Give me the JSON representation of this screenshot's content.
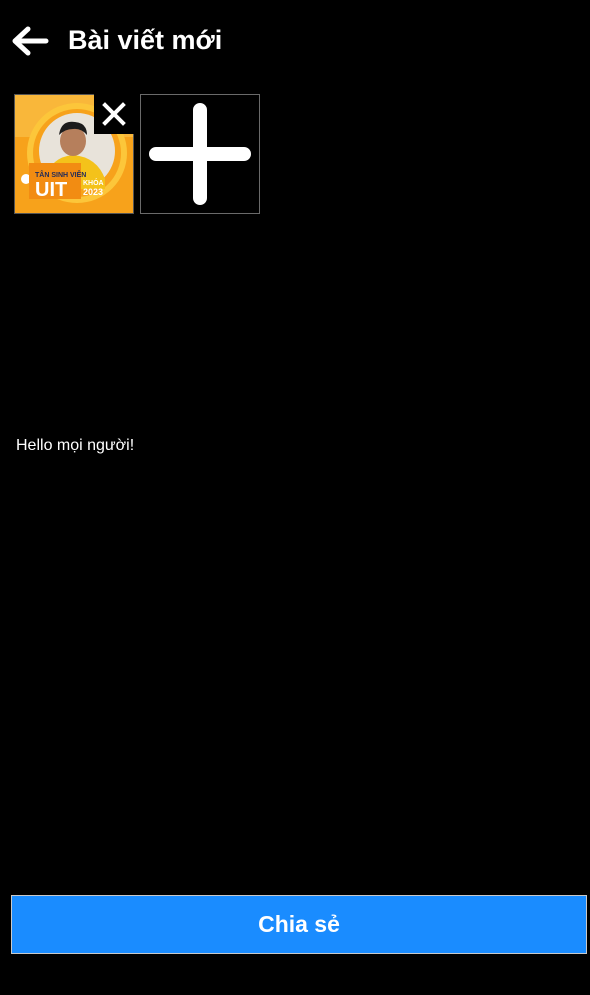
{
  "header": {
    "title": "Bài viết mới",
    "back_icon": "arrow-left-icon"
  },
  "media": {
    "thumbnail": {
      "badge_lines": [
        "TÂN SINH VIÊN",
        "UIT",
        "KHÓA",
        "2023"
      ],
      "remove_icon": "close-icon"
    },
    "add_icon": "plus-icon"
  },
  "post": {
    "caption": "Hello mọi người!"
  },
  "actions": {
    "share_label": "Chia sẻ"
  },
  "colors": {
    "background": "#000000",
    "accent": "#1a8cff",
    "thumb_orange": "#f7a21b",
    "thumb_yellow": "#ffd21f"
  }
}
